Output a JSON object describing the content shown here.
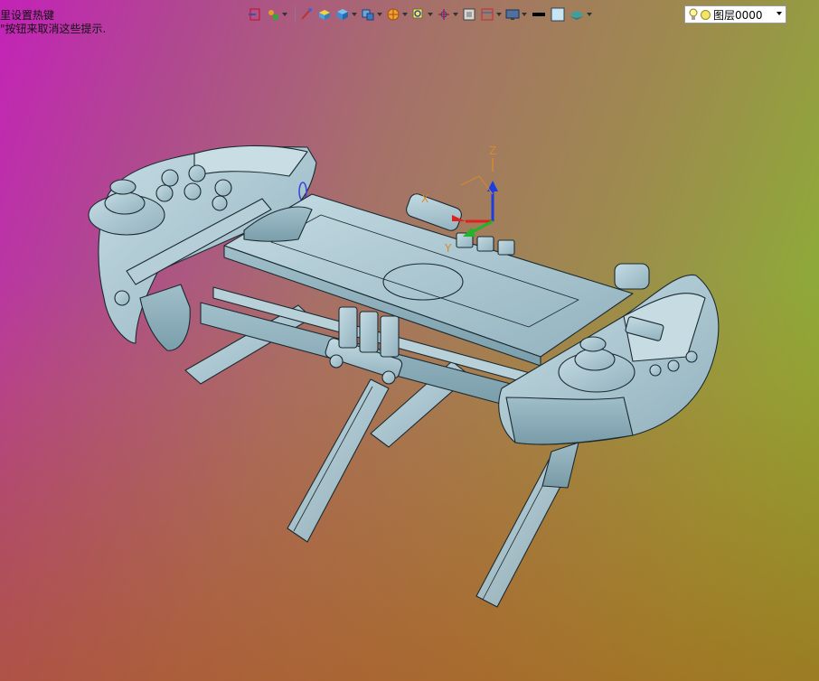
{
  "hints": {
    "line1": "里设置热键",
    "line2": "\"按钮来取消这些提示."
  },
  "toolbar": {
    "items": [
      "open-icon",
      "snap-icon",
      "pen-icon",
      "box-icon",
      "cube-icon",
      "view-icon",
      "render-icon",
      "zoom-icon",
      "axis-icon",
      "frame-icon",
      "section-icon",
      "display-icon",
      "line-color-icon",
      "fill-color-icon",
      "layer-icon"
    ]
  },
  "layer": {
    "name": "图层0000"
  },
  "axes": {
    "x": "X",
    "y": "Y",
    "z": "Z"
  },
  "colors": {
    "model_fill": "#a9c5cf",
    "model_edge": "#1b2a30",
    "axis_x": "#e0201c",
    "axis_y": "#22b42a",
    "axis_z": "#1c3ce0",
    "axis_label": "#d58a2c"
  }
}
